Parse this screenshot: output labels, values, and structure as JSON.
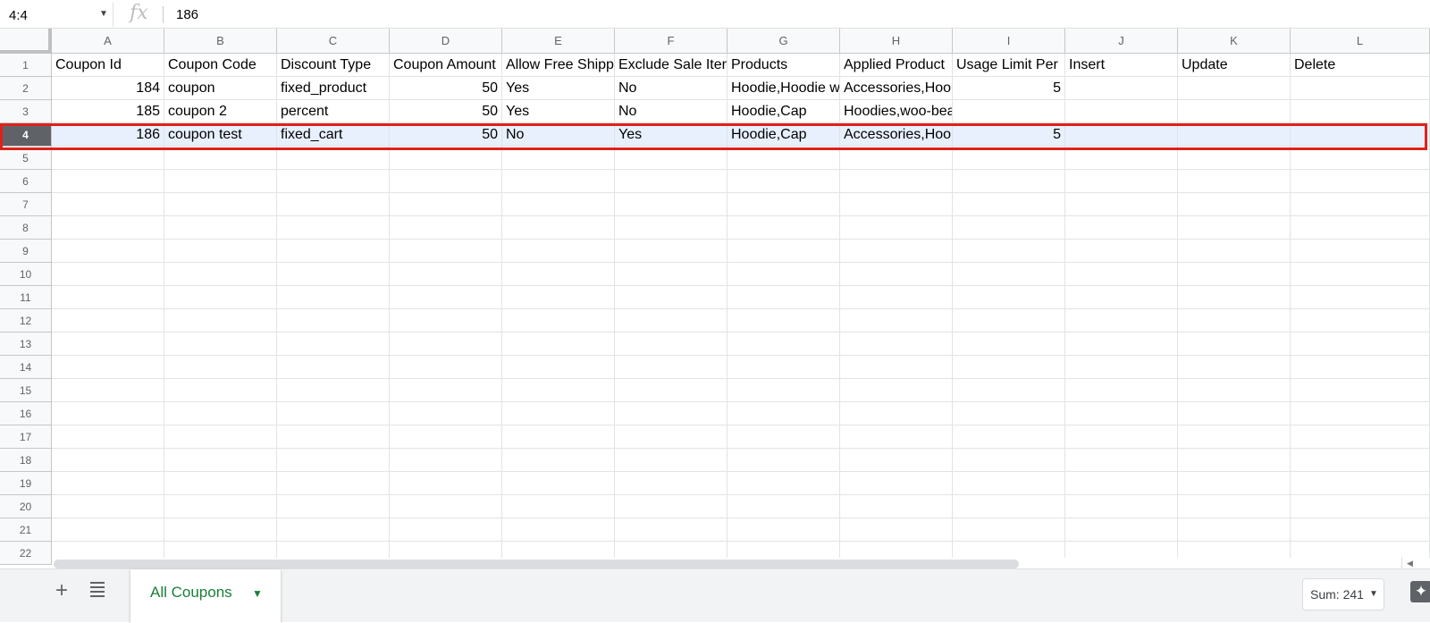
{
  "formula_bar": {
    "name_box": "4:4",
    "fx_label": "fx",
    "value": "186"
  },
  "columns": [
    "A",
    "B",
    "C",
    "D",
    "E",
    "F",
    "G",
    "H",
    "I",
    "J",
    "K",
    "L"
  ],
  "row_numbers": [
    "1",
    "2",
    "3",
    "4",
    "5",
    "6",
    "7",
    "8",
    "9",
    "10",
    "11",
    "12",
    "13",
    "14",
    "15",
    "16",
    "17",
    "18",
    "19",
    "20",
    "21",
    "22"
  ],
  "selected_row": 4,
  "rows": [
    [
      "Coupon Id",
      "Coupon Code",
      "Discount Type",
      "Coupon Amount",
      "Allow Free Shipping",
      "Exclude Sale Items",
      "Products",
      "Applied Product",
      "Usage Limit Per",
      "Insert",
      "Update",
      "Delete"
    ],
    [
      "184",
      "coupon",
      "fixed_product",
      "50",
      "Yes",
      "No",
      "Hoodie,Hoodie w",
      "Accessories,Hoo",
      "5",
      "",
      "",
      ""
    ],
    [
      "185",
      "coupon 2",
      "percent",
      "50",
      "Yes",
      "No",
      "Hoodie,Cap",
      "Hoodies,woo-beanie",
      "",
      "",
      "",
      ""
    ],
    [
      "186",
      "coupon test",
      "fixed_cart",
      "50",
      "No",
      "Yes",
      "Hoodie,Cap",
      "Accessories,Hoo",
      "5",
      "",
      "",
      ""
    ]
  ],
  "sheet_tab": {
    "label": "All Coupons"
  },
  "status": {
    "sum_label": "Sum: 241"
  },
  "colors": {
    "selection_outline": "#e0201b",
    "tab_text": "#188038",
    "selected_row_fill": "#e8f0fe"
  }
}
